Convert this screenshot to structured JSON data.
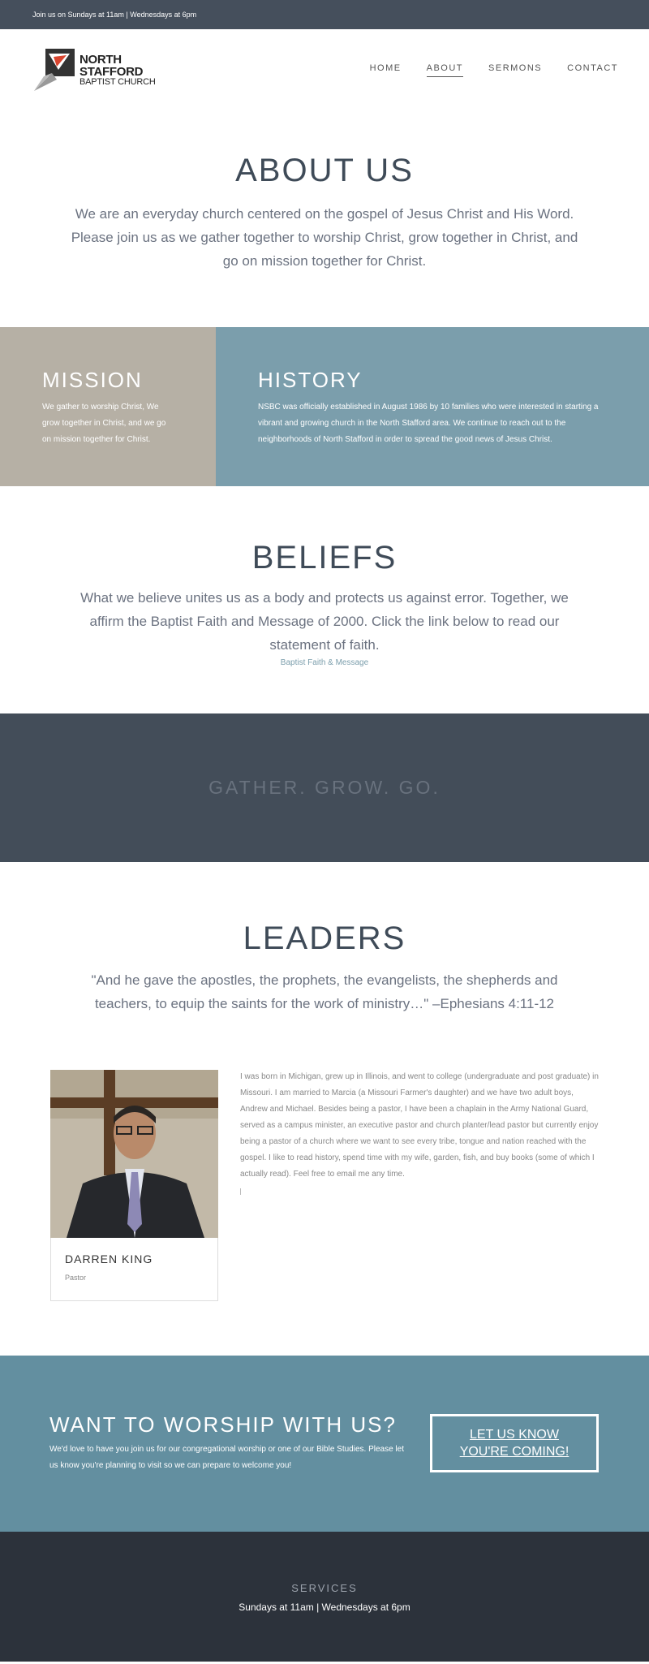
{
  "topbar": {
    "text": "Join us on Sundays at 11am | Wednesdays at 6pm"
  },
  "logo": {
    "line1": "NORTH",
    "line2": "STAFFORD",
    "line3": "BAPTIST CHURCH"
  },
  "nav": {
    "items": [
      {
        "label": "HOME"
      },
      {
        "label": "ABOUT",
        "active": true
      },
      {
        "label": "SERMONS"
      },
      {
        "label": "CONTACT"
      }
    ]
  },
  "about": {
    "title": "ABOUT US",
    "text": "We are an everyday church centered on the gospel of Jesus Christ and His Word. Please join us as we gather together to worship Christ, grow together in Christ, and go on mission together for Christ."
  },
  "mission": {
    "title": "MISSION",
    "text": "We gather to worship Christ, We grow together in Christ, and we go on mission together for Christ."
  },
  "history": {
    "title": "HISTORY",
    "text": "NSBC was officially established in August 1986 by 10 families who were interested in starting a vibrant and growing church in the North Stafford area. We continue to reach out to the neighborhoods of North Stafford in order to spread the good news of Jesus Christ."
  },
  "beliefs": {
    "title": "BELIEFS",
    "text": "What we believe unites us as a body and protects us against error. Together, we affirm the Baptist Faith and Message of 2000. Click the link below to read our statement of faith.",
    "link": "Baptist Faith & Message"
  },
  "banner": {
    "text": "GATHER. GROW. GO."
  },
  "leaders": {
    "title": "LEADERS",
    "quote": "\"And he gave the apostles, the prophets, the evangelists, the shepherds and teachers, to equip the saints for the work of ministry…\" –Ephesians 4:11-12",
    "leader": {
      "name": "DARREN KING",
      "role": "Pastor",
      "bio": "I was born in Michigan, grew up in Illinois, and went to college (undergraduate and post graduate) in Missouri. I am married to Marcia (a Missouri Farmer's daughter) and we have two adult boys, Andrew and Michael. Besides being a pastor, I have been a chaplain in the Army National Guard, served as a campus minister, an executive pastor and church planter/lead pastor but currently enjoy being a pastor of a church where we want to see every tribe, tongue and nation reached with the gospel. I like to read history, spend time with my wife, garden, fish, and buy books (some of which I actually read). Feel free to email me any time."
    }
  },
  "cta": {
    "title": "WANT TO WORSHIP WITH US?",
    "text": "We'd love to have you join us for our congregational worship or one of our Bible Studies. Please let us know you're planning to visit so we can prepare to welcome you!",
    "button": "LET US KNOW YOU'RE COMING!"
  },
  "footer": {
    "title": "SERVICES",
    "text": "Sundays at 11am | Wednesdays at 6pm"
  }
}
